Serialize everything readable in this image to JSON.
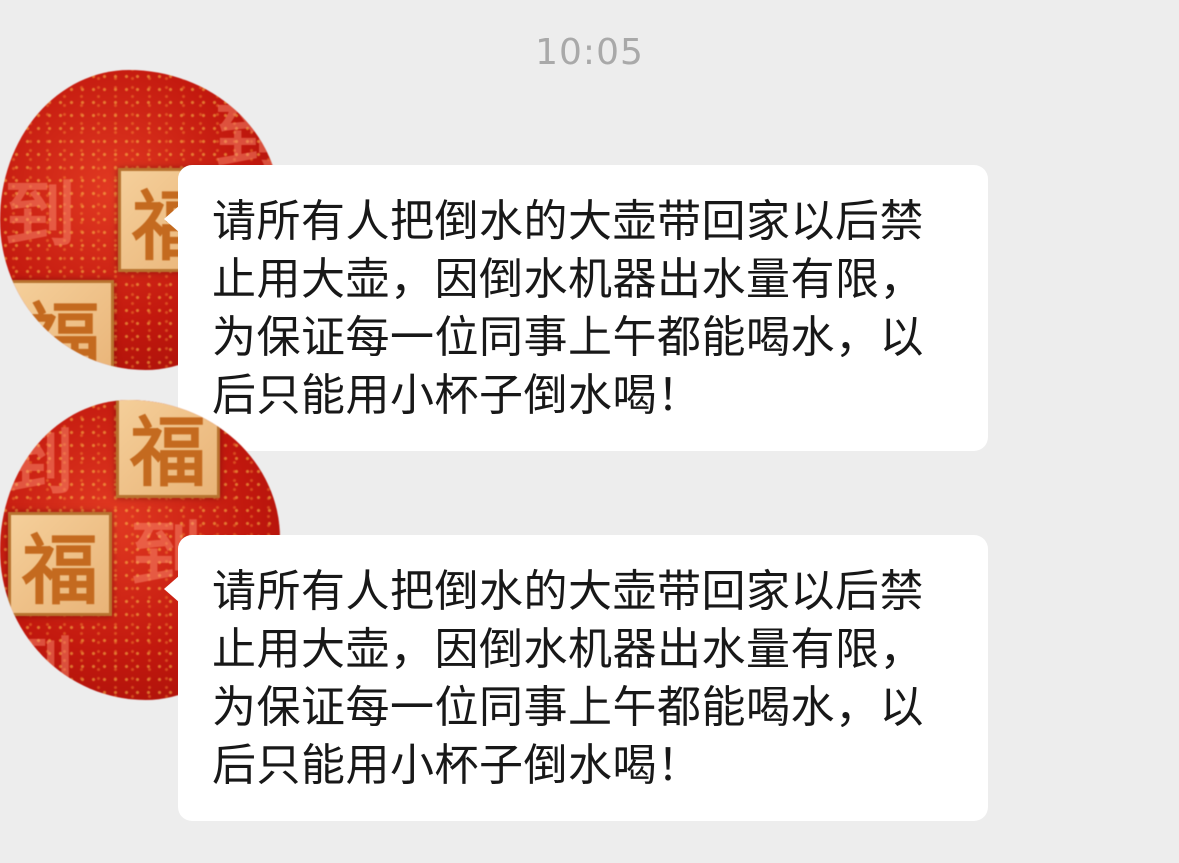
{
  "timestamp": "10:05",
  "messages": [
    {
      "text": "请所有人把倒水的大壶带回家以后禁止用大壶，因倒水机器出水量有限，为保证每一位同事上午都能喝水，以后只能用小杯子倒水喝！",
      "avatar": {
        "tile_char": "福",
        "ghost_char": "到"
      }
    },
    {
      "text": "请所有人把倒水的大壶带回家以后禁止用大壶，因倒水机器出水量有限，为保证每一位同事上午都能喝水，以后只能用小杯子倒水喝！",
      "avatar": {
        "tile_char": "福",
        "ghost_char": "到"
      }
    }
  ]
}
